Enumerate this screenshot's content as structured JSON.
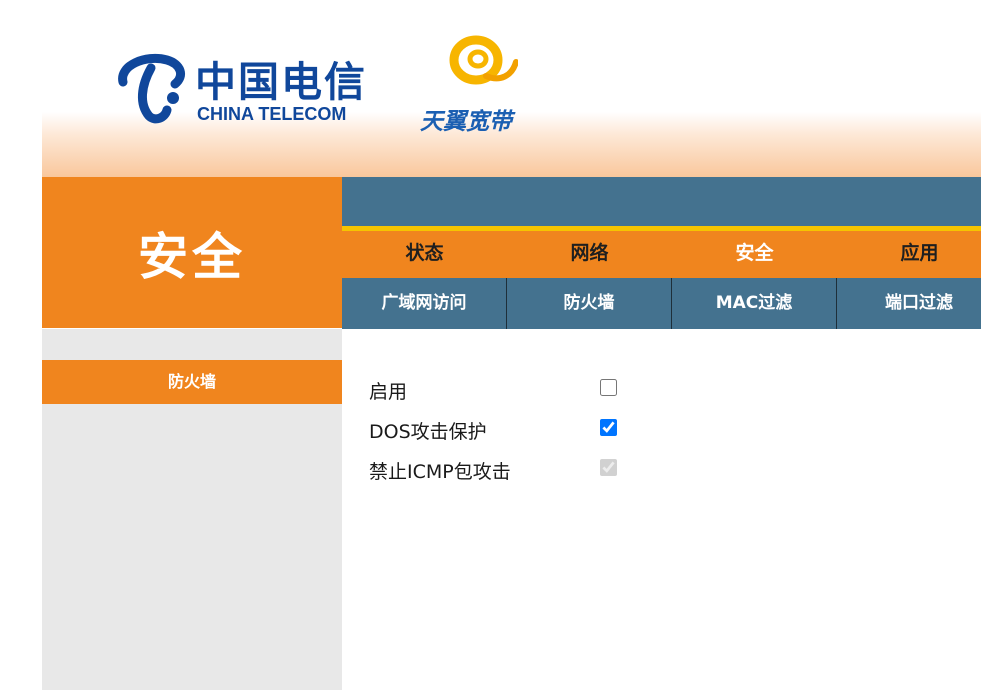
{
  "header": {
    "brand_cn": "中国电信",
    "brand_en": "CHINA TELECOM",
    "subbrand": "天翼宽带",
    "brand_color": "#10479b",
    "subbrand_color": "#1b5fb2"
  },
  "section_title": "安全",
  "main_nav": {
    "tabs": [
      {
        "label": "状态"
      },
      {
        "label": "网络"
      },
      {
        "label": "安全",
        "active": true
      },
      {
        "label": "应用"
      }
    ]
  },
  "sub_nav": {
    "tabs": [
      {
        "label": "广域网访问"
      },
      {
        "label": "防火墙",
        "active": true
      },
      {
        "label": "MAC过滤"
      },
      {
        "label": "端口过滤"
      }
    ]
  },
  "sidebar": {
    "items": [
      {
        "label": "防火墙",
        "active": true
      }
    ]
  },
  "form": {
    "rows": [
      {
        "label": "启用",
        "checked": false,
        "disabled": false
      },
      {
        "label": "DOS攻击保护",
        "checked": true,
        "disabled": false
      },
      {
        "label": "禁止ICMP包攻击",
        "checked": true,
        "disabled": true
      }
    ]
  },
  "colors": {
    "accent_orange": "#f0851e",
    "nav_blue": "#44728f",
    "highlight_yellow": "#f6c400",
    "sidebar_gray": "#e8e8e8"
  }
}
